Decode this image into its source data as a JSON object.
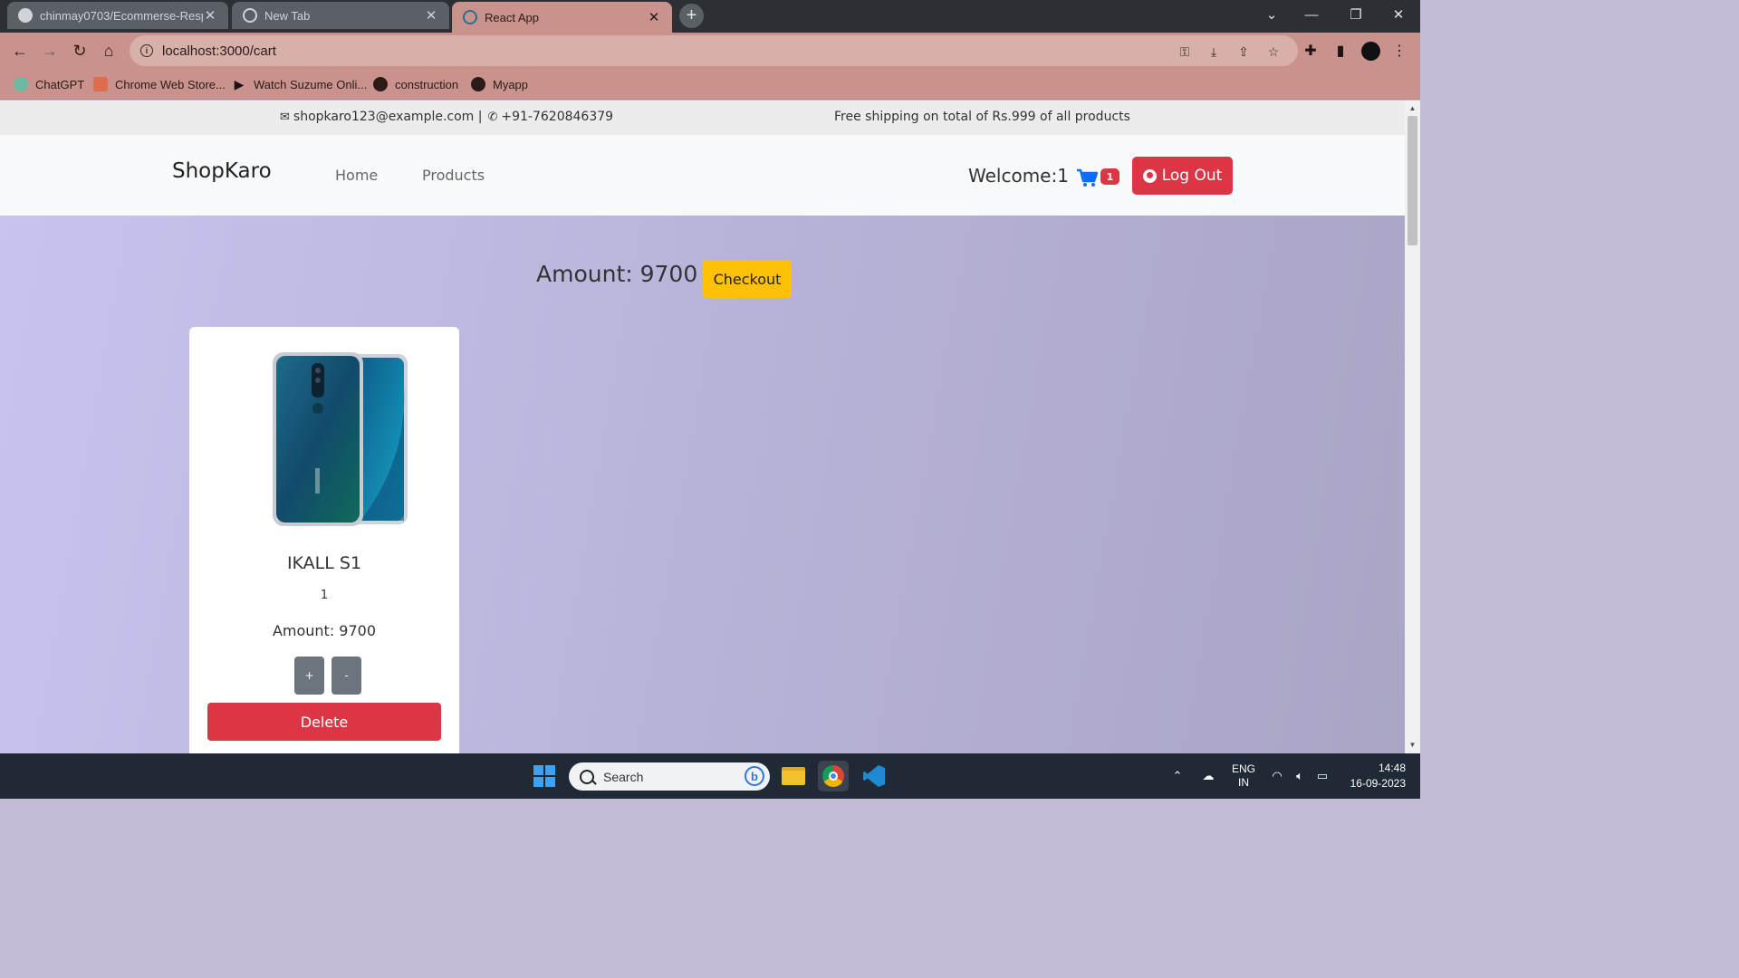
{
  "browser": {
    "tabs": [
      {
        "title": "chinmay0703/Ecommerse-Respo",
        "active": false
      },
      {
        "title": "New Tab",
        "active": false
      },
      {
        "title": "React App",
        "active": true
      }
    ],
    "url": "localhost:3000/cart",
    "bookmarks": [
      "ChatGPT",
      "Chrome Web Store...",
      "Watch Suzume Onli...",
      "construction",
      "Myapp"
    ]
  },
  "topbar": {
    "email": "shopkaro123@example.com |",
    "phone": "+91-7620846379",
    "shipping": "Free shipping on total of Rs.999 of all products"
  },
  "navbar": {
    "brand": "ShopKaro",
    "links": [
      "Home",
      "Products"
    ],
    "welcome": "Welcome:1",
    "cart_count": "1",
    "logout_label": "Log Out"
  },
  "cart": {
    "total_label": "Amount: 9700",
    "checkout_label": "Checkout",
    "items": [
      {
        "name": "IKALL S1",
        "quantity": "1",
        "amount": "Amount: 9700",
        "plus_label": "+",
        "minus_label": "-",
        "delete_label": "Delete"
      }
    ]
  },
  "taskbar": {
    "search_placeholder": "Search",
    "language_line1": "ENG",
    "language_line2": "IN",
    "time": "14:48",
    "date": "16-09-2023"
  },
  "colors": {
    "brand_red": "#dc3545",
    "checkout_yellow": "#ffc107",
    "chrome_tab": "#c9928c"
  }
}
